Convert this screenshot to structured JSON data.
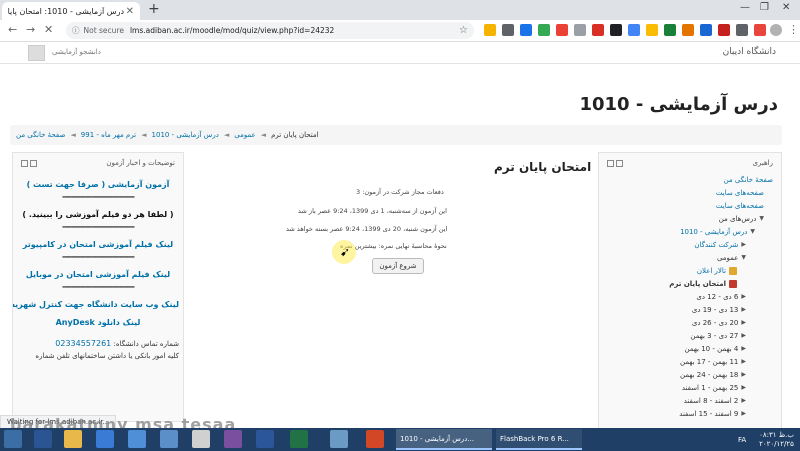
{
  "browser": {
    "tab_title": "درس آزمایشی - 1010: امتحان پایان",
    "url_prefix": "Not secure",
    "url": "lms.adiban.ac.ir/moodle/mod/quiz/view.php?id=24232"
  },
  "site": {
    "name": "دانشگاه ادیبان",
    "user_name": "دانشجو آزمایشی"
  },
  "page": {
    "title": "درس آزمایشی - 1010"
  },
  "breadcrumb": [
    "صفحهٔ خانگی من",
    "ترم مهر ماه - 991",
    "درس آزمایشی - 1010",
    "عمومی",
    "امتحان پایان ترم"
  ],
  "navigation": {
    "title": "راهبری",
    "items": [
      {
        "label": "صفحهٔ خانگی من",
        "style": "link",
        "indent": 0
      },
      {
        "label": "صفحه‌های سایت",
        "style": "link",
        "indent": 1
      },
      {
        "label": "صفحه‌های سایت",
        "style": "link",
        "indent": 1
      },
      {
        "label": "درس‌های من",
        "style": "dark",
        "indent": 1,
        "tri": "▼"
      },
      {
        "label": "درس آزمایشی - 1010",
        "style": "link",
        "indent": 2,
        "tri": "▼"
      },
      {
        "label": "شرکت کنندگان",
        "style": "link",
        "indent": 3,
        "tri": "▶"
      },
      {
        "label": "عمومی",
        "style": "dark",
        "indent": 3,
        "tri": "▼"
      },
      {
        "label": "تالار اعلان",
        "style": "link",
        "indent": 4,
        "icon": "forum-icon"
      },
      {
        "label": "امتحان پایان ترم",
        "style": "bold",
        "indent": 4,
        "icon": "quiz-icon"
      },
      {
        "label": "6 دی - 12 دی",
        "style": "dark",
        "indent": 3,
        "tri": "▶"
      },
      {
        "label": "13 دی - 19 دی",
        "style": "dark",
        "indent": 3,
        "tri": "▶"
      },
      {
        "label": "20 دی - 26 دی",
        "style": "dark",
        "indent": 3,
        "tri": "▶"
      },
      {
        "label": "27 دی - 3 بهمن",
        "style": "dark",
        "indent": 3,
        "tri": "▶"
      },
      {
        "label": "4 بهمن - 10 بهمن",
        "style": "dark",
        "indent": 3,
        "tri": "▶"
      },
      {
        "label": "11 بهمن - 17 بهمن",
        "style": "dark",
        "indent": 3,
        "tri": "▶"
      },
      {
        "label": "18 بهمن - 24 بهمن",
        "style": "dark",
        "indent": 3,
        "tri": "▶"
      },
      {
        "label": "25 بهمن - 1 اسفند",
        "style": "dark",
        "indent": 3,
        "tri": "▶"
      },
      {
        "label": "2 اسفند - 8 اسفند",
        "style": "dark",
        "indent": 3,
        "tri": "▶"
      },
      {
        "label": "9 اسفند - 15 اسفند",
        "style": "dark",
        "indent": 3,
        "tri": "▶"
      }
    ]
  },
  "quiz": {
    "title": "امتحان پایان ترم",
    "attempts": "دفعات مجاز شرکت در آزمون: 3",
    "opened": "این آزمون از سه‌شنبه، 1 دی 1399، 9:24 عصر باز شد",
    "closes": "این آزمون شنبه، 20 دی 1399، 9:24 عصر بسته خواهد شد",
    "grading": "نحوهٔ محاسبهٔ نهایی نمره: بیشترین نمره",
    "start_button": "شروع آزمون"
  },
  "description": {
    "title": "توضیحات و اخبار آزمون",
    "lines": [
      {
        "text": "آزمون آزمایشی ( صرفا جهت تست )",
        "style": "link"
      },
      {
        "text": "-------------------------------",
        "style": "dash"
      },
      {
        "text": "( لطفا هر دو فیلم آموزشی را ببینید. )",
        "style": "black"
      },
      {
        "text": "-------------------------------",
        "style": "dash"
      },
      {
        "text": "لینک فیلم آموزشی امتحان در کامپیوتر",
        "style": "link"
      },
      {
        "text": "-------------------------------",
        "style": "dash"
      },
      {
        "text": "لینک فیلم آموزشی امتحان در موبایل",
        "style": "link"
      },
      {
        "text": "-------------------------------",
        "style": "dash"
      },
      {
        "text": "لینک وب سایت دانشگاه جهت کنترل شهریه",
        "style": "link"
      },
      {
        "text": "لینک دانلود AnyDesk",
        "style": "link"
      }
    ],
    "phone_label": "شماره تماس دانشگاه:",
    "phone": "02334557261",
    "extra": "کلیه امور بانکی یا داشتن ساختمانهای تلفن شماره"
  },
  "status_bar": "Waiting for lms.adiban.ac.ir...",
  "watermark": "barakatmny msa tesaa",
  "taskbar": {
    "windows": [
      "درس آزمایشی - 1010...",
      "FlashBack Pro 6 R..."
    ],
    "time": "۰۸:۳۱ ب.ظ",
    "date": "۲۰۲۰/۱۲/۲۵",
    "lang": "FA"
  },
  "colors": {
    "link": "#0070a8",
    "taskbar": "#1f3f66",
    "tabstrip": "#dee1e6"
  }
}
